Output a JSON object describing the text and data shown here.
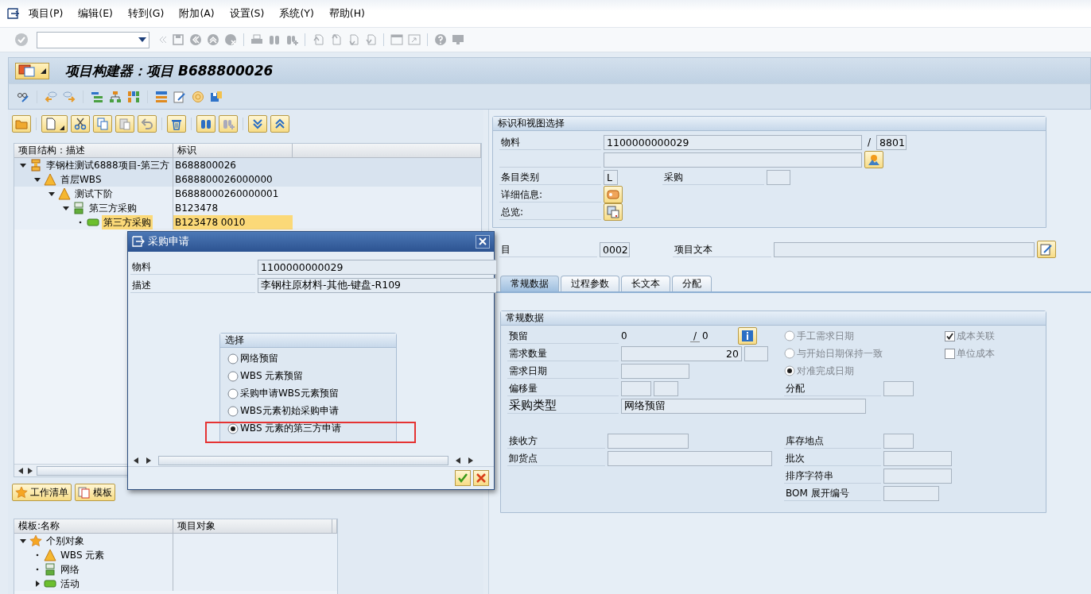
{
  "menu": [
    {
      "label": "项目(P)"
    },
    {
      "label": "编辑(E)"
    },
    {
      "label": "转到(G)"
    },
    {
      "label": "附加(A)"
    },
    {
      "label": "设置(S)"
    },
    {
      "label": "系统(Y)"
    },
    {
      "label": "帮助(H)"
    }
  ],
  "title": "项目构建器：项目 B688800026",
  "structure": {
    "columns": [
      "项目结构：描述",
      "标识"
    ],
    "rows": [
      {
        "kind": "project",
        "label": "李钢柱测试6888项目-第三方",
        "id": "B688800026",
        "expanded": true,
        "selected": false,
        "children": [
          {
            "kind": "wbs",
            "label": "首层WBS",
            "id": "B688800026000000",
            "expanded": true,
            "selected": false,
            "children": [
              {
                "kind": "wbs",
                "label": "测试下阶",
                "id": "B6888000260000001",
                "expanded": true,
                "selected": false,
                "children": [
                  {
                    "kind": "network",
                    "label": "第三方采购",
                    "id": "B123478",
                    "expanded": true,
                    "selected": false,
                    "children": [
                      {
                        "kind": "activity",
                        "label": "第三方采购",
                        "id": "B123478 0010",
                        "selected": true
                      }
                    ]
                  }
                ]
              }
            ]
          }
        ]
      }
    ]
  },
  "list_buttons": [
    {
      "kind": "star",
      "label": "工作清单"
    },
    {
      "kind": "template",
      "label": "模板"
    }
  ],
  "templates": {
    "columns": [
      "模板:名称",
      "项目对象"
    ],
    "rows": [
      {
        "kind": "star",
        "label": "个别对象",
        "expanded": true,
        "children": [
          {
            "kind": "wbs",
            "label": "WBS 元素"
          },
          {
            "kind": "network",
            "label": "网络"
          },
          {
            "kind": "activity",
            "label": "活动",
            "expanded": false
          }
        ]
      }
    ]
  },
  "identification": {
    "title": "标识和视图选择",
    "material_label": "物料",
    "material": "1100000000029",
    "separator": "/",
    "plant": "8801",
    "category_label": "条目类别",
    "category": "L",
    "purchasing_label": "采购",
    "details_label": "详细信息:",
    "overview_label": "总览:"
  },
  "item": {
    "label": "目",
    "value": "0002",
    "text_label": "项目文本"
  },
  "tabs": [
    {
      "label": "常规数据",
      "selected": true
    },
    {
      "label": "过程参数",
      "selected": false
    },
    {
      "label": "长文本",
      "selected": false
    },
    {
      "label": "分配",
      "selected": false
    }
  ],
  "general": {
    "title": "常规数据",
    "reservation_label": "预留",
    "reservation": "0",
    "reservation_separator": "/",
    "reservation_total": "0",
    "quantity_label": "需求数量",
    "quantity": "20",
    "date_label": "需求日期",
    "offset_label": "偏移量",
    "type_label": "采购类型",
    "type": "网络预留",
    "date_options": [
      {
        "label": "手工需求日期",
        "selected": false,
        "disabled": true
      },
      {
        "label": "与开始日期保持一致",
        "selected": false,
        "disabled": true
      },
      {
        "label": "对准完成日期",
        "selected": true,
        "disabled": true
      }
    ],
    "cost_flags": [
      {
        "label": "成本关联",
        "checked": true,
        "disabled": true
      },
      {
        "label": "单位成本",
        "checked": false,
        "disabled": true
      }
    ],
    "allocation_label": "分配",
    "recipient_label": "接收方",
    "unloading_label": "卸货点",
    "storage_label": "库存地点",
    "batch_label": "批次",
    "sort_label": "排序字符串",
    "bom_label": "BOM 展开编号"
  },
  "dialog": {
    "title": "采购申请",
    "fields": [
      {
        "label": "物料",
        "value": "1100000000029"
      },
      {
        "label": "描述",
        "value": "李钢柱原材料-其他-键盘-R109"
      }
    ],
    "group_title": "选择",
    "options": [
      {
        "label": "网络预留",
        "selected": false,
        "highlighted": false
      },
      {
        "label": "WBS 元素预留",
        "selected": false,
        "highlighted": false
      },
      {
        "label": "采购申请WBS元素预留",
        "selected": false,
        "highlighted": false
      },
      {
        "label": "WBS元素初始采购申请",
        "selected": false,
        "highlighted": false
      },
      {
        "label": "WBS 元素的第三方申请",
        "selected": true,
        "highlighted": true
      }
    ]
  }
}
